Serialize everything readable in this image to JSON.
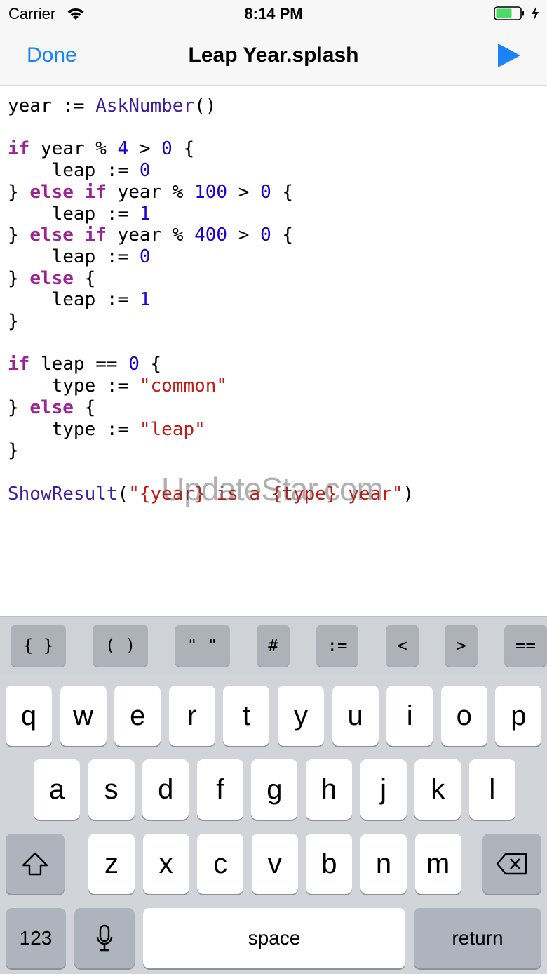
{
  "status_bar": {
    "carrier": "Carrier",
    "time": "8:14 PM"
  },
  "nav": {
    "done_label": "Done",
    "title": "Leap Year.splash",
    "run_icon": "play-icon"
  },
  "colors": {
    "accent": "#1a82fb",
    "keyword": "#9b2393",
    "number": "#1c00cf",
    "string": "#c41a16",
    "function": "#3c1f9e",
    "battery": "#4cd964"
  },
  "watermark": "UpdateStar.com",
  "code_lines": [
    [
      [
        "t",
        "year := "
      ],
      [
        "f",
        "AskNumber"
      ],
      [
        "t",
        "()"
      ]
    ],
    [],
    [
      [
        "k",
        "if"
      ],
      [
        "t",
        " year % "
      ],
      [
        "n",
        "4"
      ],
      [
        "t",
        " > "
      ],
      [
        "n",
        "0"
      ],
      [
        "t",
        " {"
      ]
    ],
    [
      [
        "t",
        "    leap := "
      ],
      [
        "n",
        "0"
      ]
    ],
    [
      [
        "t",
        "} "
      ],
      [
        "k",
        "else if"
      ],
      [
        "t",
        " year % "
      ],
      [
        "n",
        "100"
      ],
      [
        "t",
        " > "
      ],
      [
        "n",
        "0"
      ],
      [
        "t",
        " {"
      ]
    ],
    [
      [
        "t",
        "    leap := "
      ],
      [
        "n",
        "1"
      ]
    ],
    [
      [
        "t",
        "} "
      ],
      [
        "k",
        "else if"
      ],
      [
        "t",
        " year % "
      ],
      [
        "n",
        "400"
      ],
      [
        "t",
        " > "
      ],
      [
        "n",
        "0"
      ],
      [
        "t",
        " {"
      ]
    ],
    [
      [
        "t",
        "    leap := "
      ],
      [
        "n",
        "0"
      ]
    ],
    [
      [
        "t",
        "} "
      ],
      [
        "k",
        "else"
      ],
      [
        "t",
        " {"
      ]
    ],
    [
      [
        "t",
        "    leap := "
      ],
      [
        "n",
        "1"
      ]
    ],
    [
      [
        "t",
        "}"
      ]
    ],
    [],
    [
      [
        "k",
        "if"
      ],
      [
        "t",
        " leap == "
      ],
      [
        "n",
        "0"
      ],
      [
        "t",
        " {"
      ]
    ],
    [
      [
        "t",
        "    type := "
      ],
      [
        "s",
        "\"common\""
      ]
    ],
    [
      [
        "t",
        "} "
      ],
      [
        "k",
        "else"
      ],
      [
        "t",
        " {"
      ]
    ],
    [
      [
        "t",
        "    type := "
      ],
      [
        "s",
        "\"leap\""
      ]
    ],
    [
      [
        "t",
        "}"
      ]
    ],
    [],
    [
      [
        "f",
        "ShowResult"
      ],
      [
        "t",
        "("
      ],
      [
        "s",
        "\"{year} is a {type} year\""
      ],
      [
        "t",
        ")"
      ]
    ]
  ],
  "accessory_keys": [
    "{ }",
    "( )",
    "\" \"",
    "#",
    ":=",
    "<",
    ">",
    "=="
  ],
  "keyboard": {
    "row1": [
      "q",
      "w",
      "e",
      "r",
      "t",
      "y",
      "u",
      "i",
      "o",
      "p"
    ],
    "row2": [
      "a",
      "s",
      "d",
      "f",
      "g",
      "h",
      "j",
      "k",
      "l"
    ],
    "row3": [
      "z",
      "x",
      "c",
      "v",
      "b",
      "n",
      "m"
    ],
    "shift_icon": "shift-icon",
    "delete_icon": "delete-icon",
    "numbers_label": "123",
    "mic_icon": "microphone-icon",
    "space_label": "space",
    "return_label": "return"
  }
}
